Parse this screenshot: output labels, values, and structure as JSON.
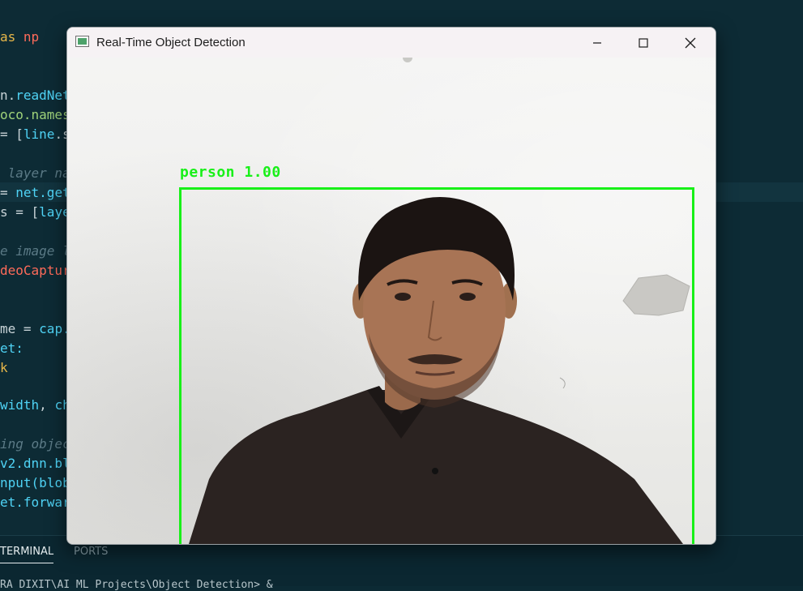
{
  "editor": {
    "lines": [
      {
        "parts": [
          {
            "t": "as ",
            "c": "c-kw"
          },
          {
            "t": "np",
            "c": "c-cls"
          }
        ]
      },
      {
        "parts": [
          {
            "t": "n.",
            "c": "c-op"
          },
          {
            "t": "readNet",
            "c": "c-var"
          }
        ]
      },
      {
        "parts": [
          {
            "t": "oco.names",
            "c": "c-str"
          }
        ]
      },
      {
        "parts": [
          {
            "t": "= [",
            "c": "c-op"
          },
          {
            "t": "line",
            "c": "c-var"
          },
          {
            "t": ".s",
            "c": "c-op"
          }
        ]
      },
      {
        "parts": [
          {
            "t": " layer na",
            "c": "c-cmt"
          }
        ]
      },
      {
        "parts": [
          {
            "t": "= ",
            "c": "c-op"
          },
          {
            "t": "net",
            "c": "c-var"
          },
          {
            "t": ".get",
            "c": "c-var"
          }
        ]
      },
      {
        "parts": [
          {
            "t": "s = [",
            "c": "c-op"
          },
          {
            "t": "laye",
            "c": "c-var"
          }
        ]
      },
      {
        "parts": [
          {
            "t": "e image l",
            "c": "c-cmt"
          }
        ]
      },
      {
        "parts": [
          {
            "t": "deoCaptur",
            "c": "c-cls"
          }
        ]
      },
      {
        "parts": [
          {
            "t": "me = ",
            "c": "c-op"
          },
          {
            "t": "cap.",
            "c": "c-var"
          }
        ]
      },
      {
        "parts": [
          {
            "t": "et:",
            "c": "c-var"
          }
        ]
      },
      {
        "parts": [
          {
            "t": "k",
            "c": "c-kw"
          }
        ]
      },
      {
        "parts": [
          {
            "t": "width",
            "c": "c-var"
          },
          {
            "t": ", ",
            "c": "c-op"
          },
          {
            "t": "ch",
            "c": "c-var"
          }
        ]
      },
      {
        "parts": [
          {
            "t": "ing objec",
            "c": "c-cmt"
          }
        ]
      },
      {
        "parts": [
          {
            "t": "v2.dnn.bl",
            "c": "c-var"
          }
        ]
      },
      {
        "parts": [
          {
            "t": "nput(",
            "c": "c-var"
          },
          {
            "t": "blob",
            "c": "c-var"
          }
        ]
      },
      {
        "parts": [
          {
            "t": "et.forwar",
            "c": "c-var"
          }
        ]
      }
    ]
  },
  "panel": {
    "terminal_tab": "TERMINAL",
    "ports_tab": "PORTS",
    "terminal_line": "RA DIXIT\\AI ML Projects\\Object Detection> & "
  },
  "window": {
    "title": "Real-Time Object Detection",
    "icons": {
      "app": "opencv-window-icon",
      "minimize": "minimize-icon",
      "maximize": "maximize-icon",
      "close": "close-icon"
    }
  },
  "detection": {
    "label": "person 1.00",
    "box_color": "#18f018"
  }
}
